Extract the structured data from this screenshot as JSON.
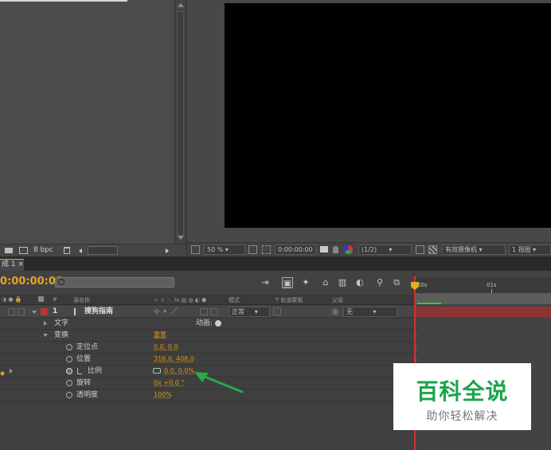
{
  "project": {
    "bit_depth": "8 bpc"
  },
  "viewer": {
    "zoom": "50 %",
    "timecode": "0:00:00:00",
    "resolution": "(1/2)",
    "camera": "有效摄像机",
    "views": "1 视图"
  },
  "timeline": {
    "comp_tab": "成 1",
    "timecode": "0:00:00:00",
    "search_placeholder": "",
    "columns": {
      "num": "#",
      "source_name": "源名称",
      "mode": "模式",
      "trkmat": "T  轨道蒙板",
      "parent": "父级"
    },
    "ruler": {
      "start": "00s",
      "mark": "01s"
    },
    "layer": {
      "index": "1",
      "name": "搜狗指南",
      "mode": "正常",
      "parent": "无"
    },
    "text_group": "文字",
    "animate_label": "动画:",
    "transform_group": "变换",
    "reset_label": "重置",
    "properties": [
      {
        "name": "定位点",
        "value": "0.0, 0.0"
      },
      {
        "name": "位置",
        "value": "316.0, 408.0"
      },
      {
        "name": "比例",
        "value": "0.0, 0.0%"
      },
      {
        "name": "旋转",
        "value": "0x +0.0 °"
      },
      {
        "name": "透明度",
        "value": "100%"
      }
    ]
  },
  "watermark": {
    "title": "百科全说",
    "subtitle": "助你轻松解决"
  },
  "colors": {
    "accent": "#e8a320",
    "layer_bar": "#8e3434",
    "arrow": "#2aa84a",
    "watermark_green": "#1aa54a"
  }
}
